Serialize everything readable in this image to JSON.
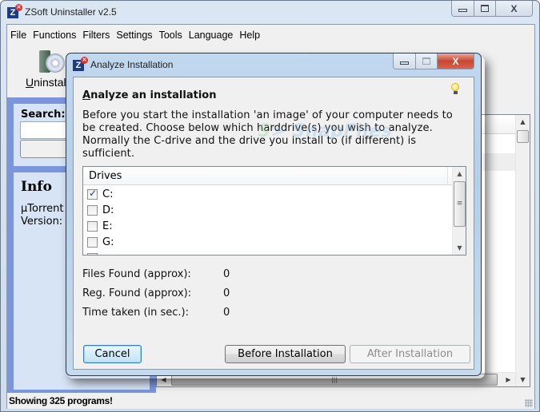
{
  "main_window": {
    "title": "ZSoft Uninstaller v2.5",
    "caption_buttons": {
      "minimize": "▭",
      "maximize": "□",
      "close": "X"
    },
    "menu": [
      "File",
      "Functions",
      "Filters",
      "Settings",
      "Tools",
      "Language",
      "Help"
    ],
    "toolbar": {
      "uninstall_label_u": "U",
      "uninstall_label_rest": "ninstal"
    },
    "search": {
      "label": "Search:",
      "value": ""
    },
    "info": {
      "heading": "Info",
      "app_name": "µTorrent",
      "version_label": "Version:"
    },
    "status": "Showing 325 programs!"
  },
  "dialog": {
    "title": "Analyze Installation",
    "caption_buttons": {
      "minimize": "▭",
      "maximize": "□",
      "close": "X"
    },
    "heading_u": "A",
    "heading_rest": "nalyze an installation",
    "description": "Before you start the installation 'an image' of your computer needs to be created. Choose below which harddrive(s) you wish to analyze. Normally the C-drive and the drive you install to (if different) is sufficient.",
    "drives_header": "Drives",
    "drives": [
      {
        "label": "C:",
        "checked": true
      },
      {
        "label": "D:",
        "checked": false
      },
      {
        "label": "E:",
        "checked": false
      },
      {
        "label": "G:",
        "checked": false
      }
    ],
    "stats": [
      {
        "label": "Files Found (approx):",
        "value": "0"
      },
      {
        "label": "Reg. Found (approx):",
        "value": "0"
      },
      {
        "label": "Time taken (in sec.):",
        "value": "0"
      }
    ],
    "buttons": {
      "cancel": "Cancel",
      "before": "Before Installation",
      "after": "After Installation"
    }
  },
  "watermark": {
    "s": "S",
    "text": "SnapFiles"
  }
}
